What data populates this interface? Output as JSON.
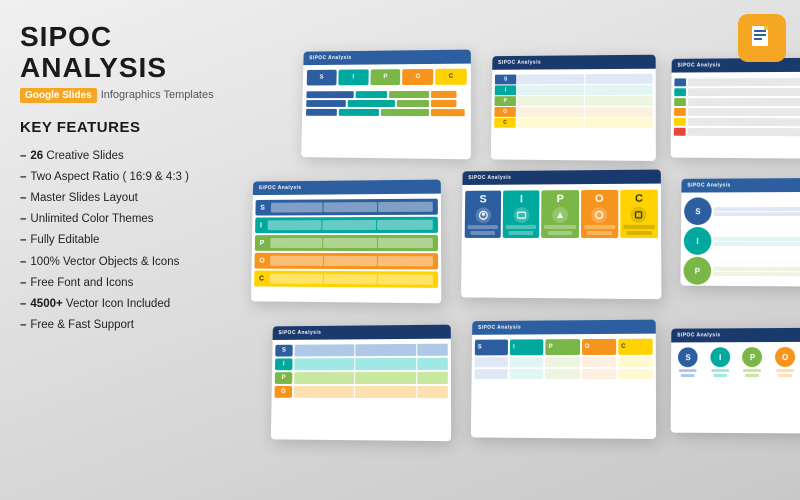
{
  "header": {
    "title": "SIPOC ANALYSIS",
    "google_label": "Google Slides",
    "subtitle": "Infographics Templates",
    "icon_alt": "google-slides-icon"
  },
  "features": {
    "heading": "KEY FEATURES",
    "items": [
      {
        "dash": "–",
        "bold": "26",
        "text": " Creative Slides"
      },
      {
        "dash": "–",
        "bold": "",
        "text": "Two Aspect Ratio ( 16:9 & 4:3 )"
      },
      {
        "dash": "–",
        "bold": "",
        "text": "Master Slides Layout"
      },
      {
        "dash": "–",
        "bold": "",
        "text": "Unlimited Color Themes"
      },
      {
        "dash": "–",
        "bold": "",
        "text": "Fully Editable"
      },
      {
        "dash": "–",
        "bold": "",
        "text": "100% Vector Objects & Icons"
      },
      {
        "dash": "–",
        "bold": "",
        "text": "Free Font and Icons"
      },
      {
        "dash": "–",
        "bold": "4500+",
        "text": " Vector Icon Included"
      },
      {
        "dash": "–",
        "bold": "",
        "text": "Free & Fast Support"
      }
    ]
  },
  "sipoc_labels": {
    "S": "S",
    "I": "I",
    "P": "P",
    "O": "O",
    "C": "C"
  },
  "slide_header_text": "SIPOC Analysis"
}
